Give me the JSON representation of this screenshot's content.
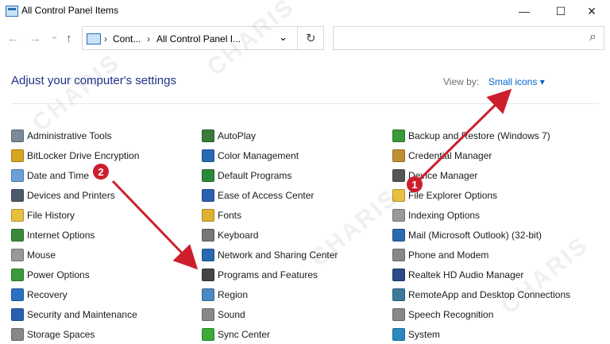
{
  "window": {
    "title": "All Control Panel Items",
    "controls": {
      "minimize": "—",
      "maximize": "☐",
      "close": "✕"
    }
  },
  "nav": {
    "back": "←",
    "forward": "→",
    "dropdown": "⌄",
    "up": "↑",
    "breadcrumbs": [
      "Cont...",
      "All Control Panel I..."
    ],
    "crumb_sep": "›",
    "addr_dropdown": "⌄",
    "refresh": "↻",
    "search_icon": "⌕"
  },
  "header": {
    "title": "Adjust your computer's settings",
    "view_by_label": "View by:",
    "view_by_value": "Small icons ▾"
  },
  "columns": [
    {
      "items": [
        {
          "label": "Administrative Tools",
          "icon": "admin-tools-icon",
          "color": "#7a8a99"
        },
        {
          "label": "BitLocker Drive Encryption",
          "icon": "bitlocker-icon",
          "color": "#d8a520"
        },
        {
          "label": "Date and Time",
          "icon": "clock-icon",
          "color": "#6a9fd8"
        },
        {
          "label": "Devices and Printers",
          "icon": "printer-icon",
          "color": "#4a5a6a"
        },
        {
          "label": "File History",
          "icon": "file-history-icon",
          "color": "#e8c040"
        },
        {
          "label": "Internet Options",
          "icon": "globe-icon",
          "color": "#3a8a3a"
        },
        {
          "label": "Mouse",
          "icon": "mouse-icon",
          "color": "#999999"
        },
        {
          "label": "Power Options",
          "icon": "power-icon",
          "color": "#3a9a3a"
        },
        {
          "label": "Recovery",
          "icon": "recovery-icon",
          "color": "#2a70c0"
        },
        {
          "label": "Security and Maintenance",
          "icon": "flag-icon",
          "color": "#2a60b0"
        },
        {
          "label": "Storage Spaces",
          "icon": "storage-icon",
          "color": "#888888"
        }
      ]
    },
    {
      "items": [
        {
          "label": "AutoPlay",
          "icon": "autoplay-icon",
          "color": "#3a7a3a"
        },
        {
          "label": "Color Management",
          "icon": "monitor-icon",
          "color": "#2a6ab0"
        },
        {
          "label": "Default Programs",
          "icon": "default-programs-icon",
          "color": "#2a8a3a"
        },
        {
          "label": "Ease of Access Center",
          "icon": "ease-of-access-icon",
          "color": "#2a60b0"
        },
        {
          "label": "Fonts",
          "icon": "fonts-icon",
          "color": "#e0b030"
        },
        {
          "label": "Keyboard",
          "icon": "keyboard-icon",
          "color": "#777777"
        },
        {
          "label": "Network and Sharing Center",
          "icon": "network-icon",
          "color": "#2a6ab0"
        },
        {
          "label": "Programs and Features",
          "icon": "programs-icon",
          "color": "#444444"
        },
        {
          "label": "Region",
          "icon": "region-icon",
          "color": "#4a8ac0"
        },
        {
          "label": "Sound",
          "icon": "sound-icon",
          "color": "#888888"
        },
        {
          "label": "Sync Center",
          "icon": "sync-icon",
          "color": "#3aaa3a"
        }
      ]
    },
    {
      "items": [
        {
          "label": "Backup and Restore (Windows 7)",
          "icon": "backup-icon",
          "color": "#3a9a3a"
        },
        {
          "label": "Credential Manager",
          "icon": "credential-icon",
          "color": "#c09030"
        },
        {
          "label": "Device Manager",
          "icon": "device-manager-icon",
          "color": "#555555"
        },
        {
          "label": "File Explorer Options",
          "icon": "folder-options-icon",
          "color": "#e8c040"
        },
        {
          "label": "Indexing Options",
          "icon": "indexing-icon",
          "color": "#999999"
        },
        {
          "label": "Mail (Microsoft Outlook) (32-bit)",
          "icon": "mail-icon",
          "color": "#2a6ab0"
        },
        {
          "label": "Phone and Modem",
          "icon": "phone-icon",
          "color": "#888888"
        },
        {
          "label": "Realtek HD Audio Manager",
          "icon": "audio-manager-icon",
          "color": "#2a4a8a"
        },
        {
          "label": "RemoteApp and Desktop Connections",
          "icon": "remoteapp-icon",
          "color": "#3a7a9a"
        },
        {
          "label": "Speech Recognition",
          "icon": "microphone-icon",
          "color": "#888888"
        },
        {
          "label": "System",
          "icon": "system-icon",
          "color": "#2a8ac0"
        }
      ]
    }
  ],
  "annotations": [
    {
      "label": "1"
    },
    {
      "label": "2"
    }
  ],
  "colors": {
    "accent_link": "#0066cc",
    "heading": "#1e3287",
    "annotation": "#cc1f2e"
  }
}
